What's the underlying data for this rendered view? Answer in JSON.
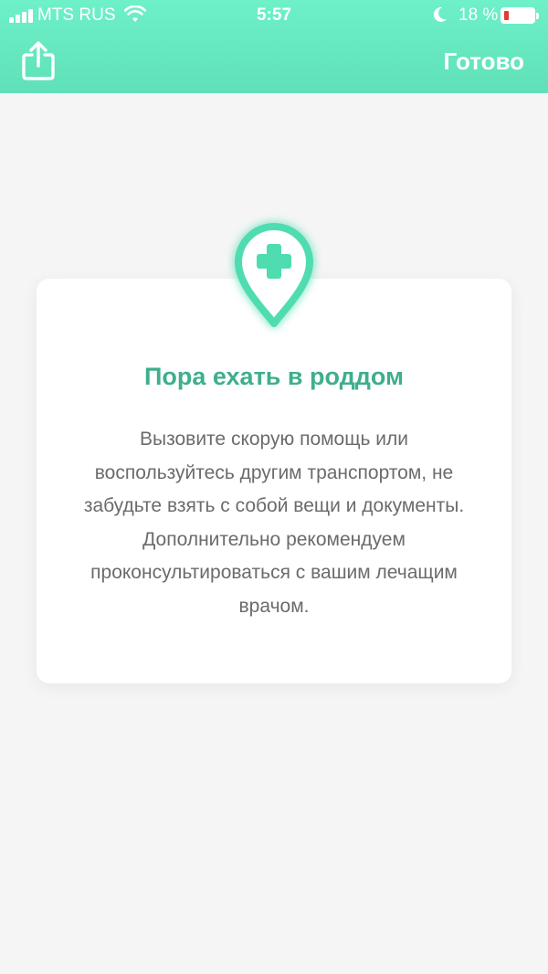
{
  "status_bar": {
    "carrier": "MTS RUS",
    "time": "5:57",
    "battery_percent": "18 %",
    "battery_level": 0.18,
    "battery_color": "#e23b34",
    "icons": [
      "signal-icon",
      "wifi-icon",
      "moon-icon",
      "battery-icon"
    ]
  },
  "nav": {
    "share_icon": "share-icon",
    "done_label": "Готово"
  },
  "card": {
    "icon": "medical-location-pin-icon",
    "title": "Пора ехать в роддом",
    "body": "Вызовите скорую помощь или воспользуйтесь другим транспортом, не забудьте взять с собой вещи и документы. Дополнительно рекомендуем проконсультироваться с вашим лечащим врачом."
  },
  "colors": {
    "accent": "#5fe0b8",
    "accent_dark": "#3fae8e",
    "pin": "#4fdcb0",
    "background": "#f5f5f5"
  }
}
